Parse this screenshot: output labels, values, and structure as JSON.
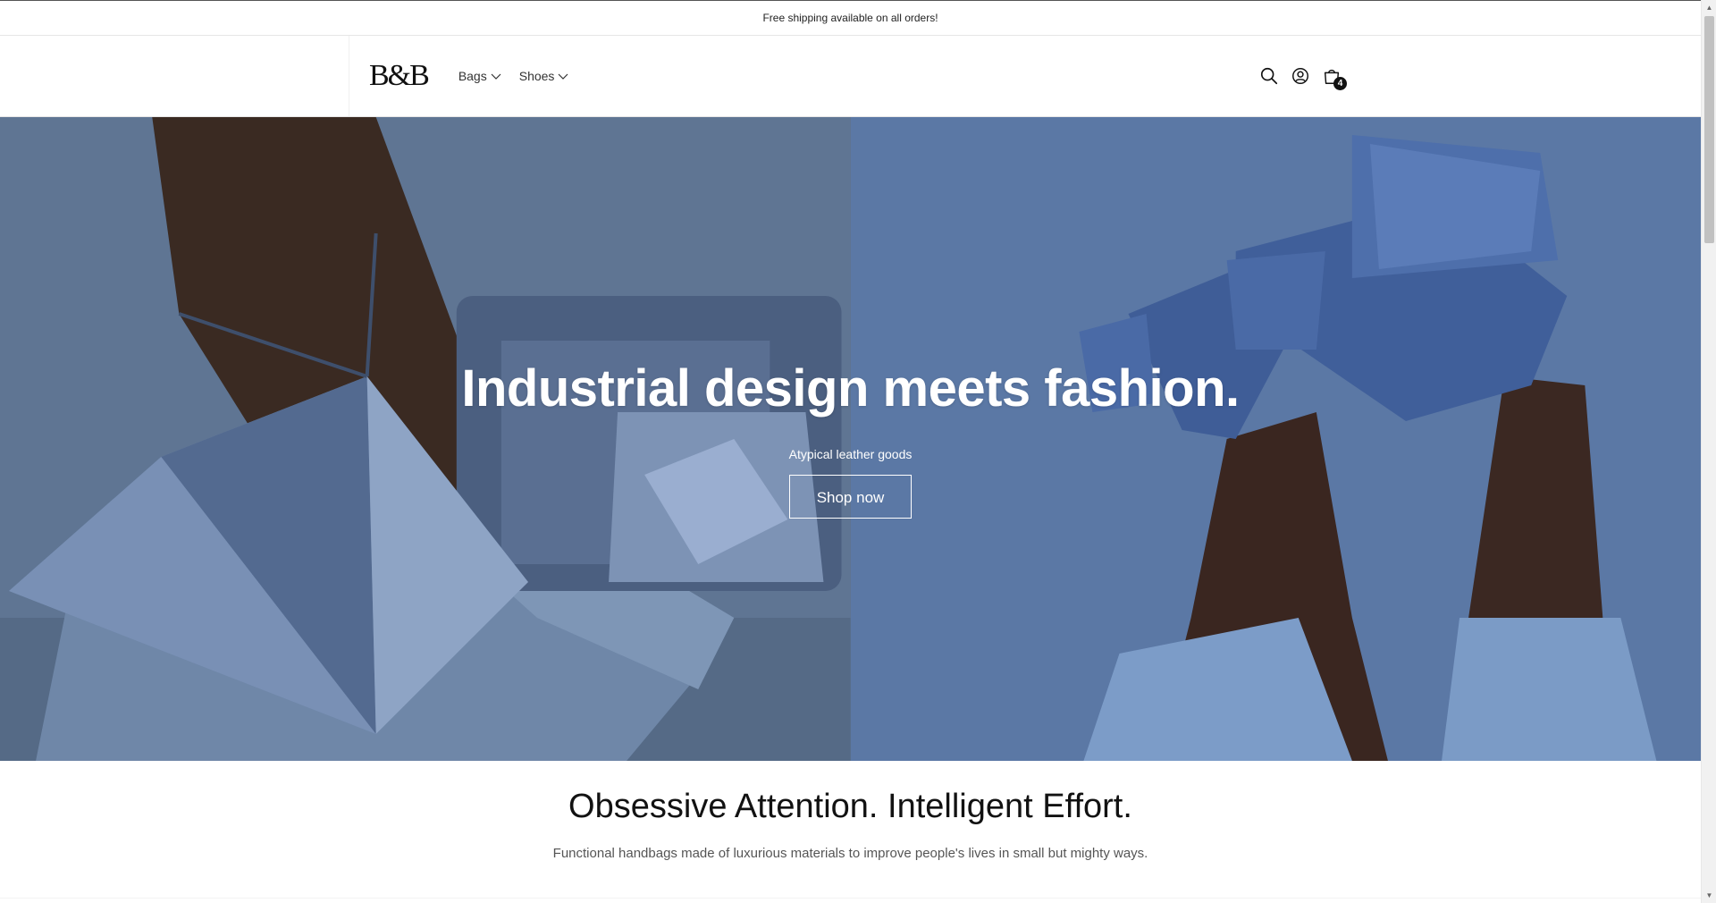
{
  "announcement": {
    "text": "Free shipping available on all orders!"
  },
  "header": {
    "logo": "B&B",
    "nav": [
      {
        "label": "Bags"
      },
      {
        "label": "Shoes"
      }
    ],
    "icons": [
      "search-icon",
      "account-icon",
      "cart-icon"
    ],
    "cart_count": "4"
  },
  "hero": {
    "title": "Industrial design meets fashion.",
    "subtitle": "Atypical leather goods",
    "button": "Shop now"
  },
  "intro": {
    "title": "Obsessive Attention. Intelligent Effort.",
    "text": "Functional handbags made of luxurious materials to improve people's lives in small but mighty ways."
  },
  "colors": {
    "hero_left": "#5c7290",
    "hero_right": "#5a76a3",
    "text_dark": "#121212"
  }
}
